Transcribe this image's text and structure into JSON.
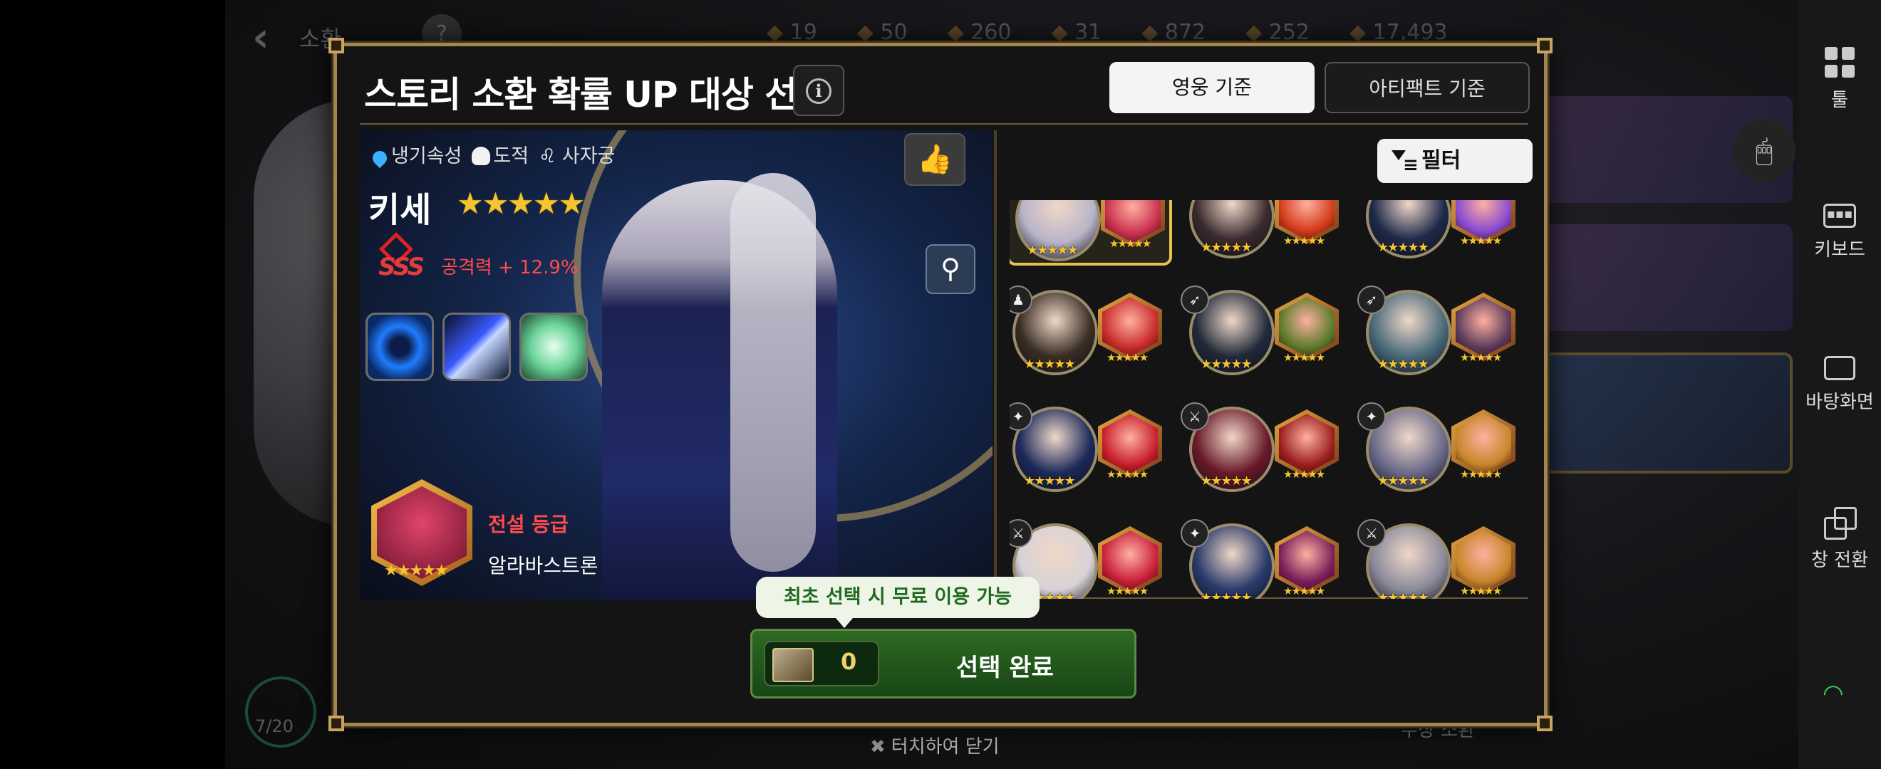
{
  "background": {
    "screen_title": "소환",
    "help_icon": "?",
    "currencies": [
      "19",
      "50",
      "260",
      "31",
      "872",
      "252",
      "17,493"
    ],
    "summon_counter": "7/20",
    "close_hint": "터치하여 닫기",
    "bottom_right_text": "무상 소환"
  },
  "modal": {
    "title": "스토리 소환 확률 UP 대상 선택",
    "info_icon": "i",
    "tabs": {
      "hero": "영웅 기준",
      "artifact": "아티팩트 기준"
    },
    "filter_label": "필터"
  },
  "hero": {
    "attributes": [
      "냉기속성",
      "도적",
      "사자궁"
    ],
    "name": "키세",
    "stars": "★★★★★",
    "grade": "SSS",
    "stat": "공격력 + 12.9%",
    "artifact_grade": "전설 등급",
    "artifact_name": "알라바스트론",
    "artifact_stars": "★★★★★"
  },
  "grid": {
    "hero_stars": "★★★★★",
    "artifact_stars": "★★★★★",
    "cells": [
      {
        "hero_color": "#b8b4c8",
        "art_color": "#c82e4e",
        "class_icon": "♟",
        "selected": true
      },
      {
        "hero_color": "#3a2a2e",
        "art_color": "#d23a1a",
        "class_icon": "⚔",
        "selected": false
      },
      {
        "hero_color": "#1e2a4a",
        "art_color": "#8a4ad0",
        "class_icon": "➶",
        "selected": false
      },
      {
        "hero_color": "#3a2e24",
        "art_color": "#c82a2a",
        "class_icon": "♟",
        "selected": false
      },
      {
        "hero_color": "#222a3a",
        "art_color": "#5a7a2a",
        "class_icon": "➶",
        "selected": false
      },
      {
        "hero_color": "#4a6a7a",
        "art_color": "#5a3a5a",
        "class_icon": "➶",
        "selected": false
      },
      {
        "hero_color": "#1c2a5a",
        "art_color": "#c81e2a",
        "class_icon": "✦",
        "selected": false
      },
      {
        "hero_color": "#6a1a2a",
        "art_color": "#9a1e1e",
        "class_icon": "⚔",
        "selected": false
      },
      {
        "hero_color": "#6a6a8a",
        "art_color": "#c8862a",
        "class_icon": "✦",
        "selected": false
      },
      {
        "hero_color": "#d8d2d6",
        "art_color": "#c81e3a",
        "class_icon": "⚔",
        "selected": false
      },
      {
        "hero_color": "#2a3a6a",
        "art_color": "#7a1e5a",
        "class_icon": "✦",
        "selected": false
      },
      {
        "hero_color": "#8a8a9a",
        "art_color": "#c8862a",
        "class_icon": "⚔",
        "selected": false
      }
    ]
  },
  "footer": {
    "free_tip": "최초 선택 시 무료 이용 가능",
    "ticket_count": "0",
    "confirm_label": "선택 완료"
  },
  "sidebar": {
    "items": [
      {
        "label": "툴",
        "icon": "grid-icon"
      },
      {
        "label": "키보드",
        "icon": "keyboard-icon"
      },
      {
        "label": "바탕화면",
        "icon": "desktop-icon"
      },
      {
        "label": "창 전환",
        "icon": "window-switch-icon"
      }
    ]
  }
}
